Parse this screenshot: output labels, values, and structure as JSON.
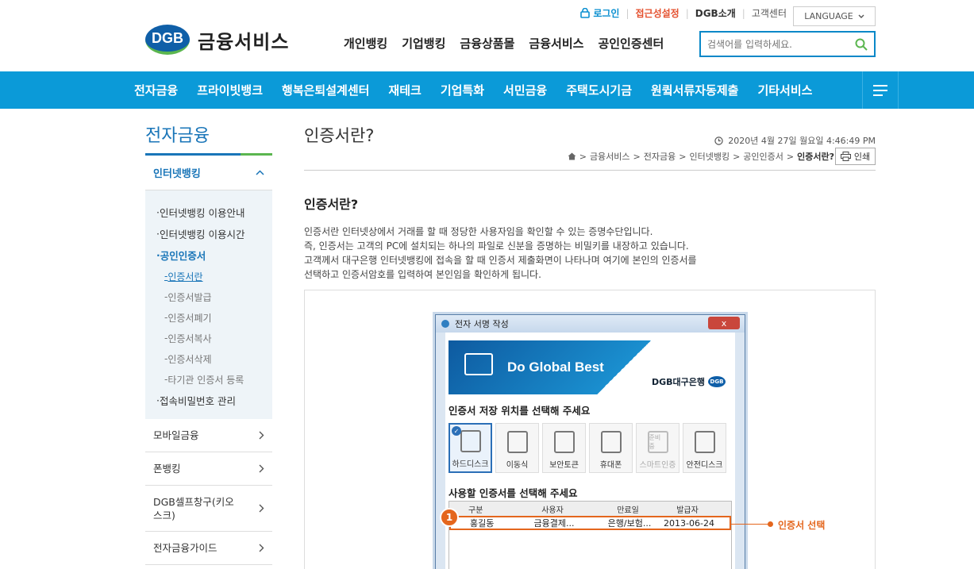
{
  "util": {
    "login": "로그인",
    "accessibility": "접근성설정",
    "dgb_intro": "DGB소개",
    "customer_center": "고객센터",
    "language": "LANGUAGE"
  },
  "logo": {
    "badge": "DGB",
    "title": "금융서비스"
  },
  "mainnav": [
    "개인뱅킹",
    "기업뱅킹",
    "금융상품몰",
    "금융서비스",
    "공인인증센터"
  ],
  "search": {
    "placeholder": "검색어를 입력하세요."
  },
  "bluebar": [
    "전자금융",
    "프라이빗뱅크",
    "행복은퇴설계센터",
    "재테크",
    "기업특화",
    "서민금융",
    "주택도시기금",
    "원큌서류자동제출",
    "기타서비스"
  ],
  "sidebar": {
    "title": "전자금융",
    "head": "인터넷뱅킹",
    "sub": [
      {
        "label": "인터넷뱅킹 이용안내",
        "level": 1
      },
      {
        "label": "인터넷뱅킹 이용시간",
        "level": 1
      },
      {
        "label": "공인인증서",
        "level": 1,
        "active": true
      },
      {
        "label": "인증서란",
        "level": 2,
        "active": true
      },
      {
        "label": "인증서발급",
        "level": 2
      },
      {
        "label": "인증서폐기",
        "level": 2
      },
      {
        "label": "인증서복사",
        "level": 2
      },
      {
        "label": "인증서삭제",
        "level": 2
      },
      {
        "label": "타기관 인증서 등록",
        "level": 2
      },
      {
        "label": "접속비밀번호 관리",
        "level": 1
      }
    ],
    "items": [
      "모바일금융",
      "폰뱅킹",
      "DGB셀프창구(키오스크)",
      "전자금융가이드"
    ]
  },
  "content": {
    "title": "인증서란?",
    "datetime": "2020년 4월 27일 월요일 4:46:49 PM",
    "breadcrumb": [
      "금융서비스",
      "전자금융",
      "인터넷뱅킹",
      "공인인증서",
      "인증서란?"
    ],
    "print": "인쇄",
    "heading": "인증서란?",
    "paragraphs": [
      "인증서란 인터넷상에서 거래를 할 때 정당한 사용자임을 확인할 수 있는 증명수단입니다.",
      "즉, 인증서는 고객의 PC에 설치되는 하나의 파일로 신분을 증명하는 비밀키를 내장하고 있습니다.",
      "고객께서 대구은행 인터넷뱅킹에 접속을 할 때 인증서 제출화면이 나타나며 여기에 본인의 인증서를",
      "선택하고 인증서암호를 입력하여 본인임을 확인하게 됩니다."
    ]
  },
  "dialog": {
    "title": "전자 서명 작성",
    "close": "x",
    "banner_text": "Do Global Best",
    "banner_bank": "DGB대구은행",
    "banner_badge": "DGB",
    "q1": "인증서 저장 위치를 선택해 주세요",
    "stores": [
      {
        "label": "하드디스크",
        "selected": true
      },
      {
        "label": "이동식"
      },
      {
        "label": "보안토큰"
      },
      {
        "label": "휴대폰"
      },
      {
        "label": "스마트인증",
        "disabled": true,
        "badge": "준비중"
      },
      {
        "label": "안전디스크"
      }
    ],
    "q2": "사용할 인증서를 선택해 주세요",
    "columns": [
      "구분",
      "사용자",
      "만료일",
      "발급자"
    ],
    "row": [
      "홍길동",
      "금융결제...",
      "은행/보험...",
      "2013-06-24"
    ],
    "step": "1",
    "callout": "인증서 선택"
  }
}
